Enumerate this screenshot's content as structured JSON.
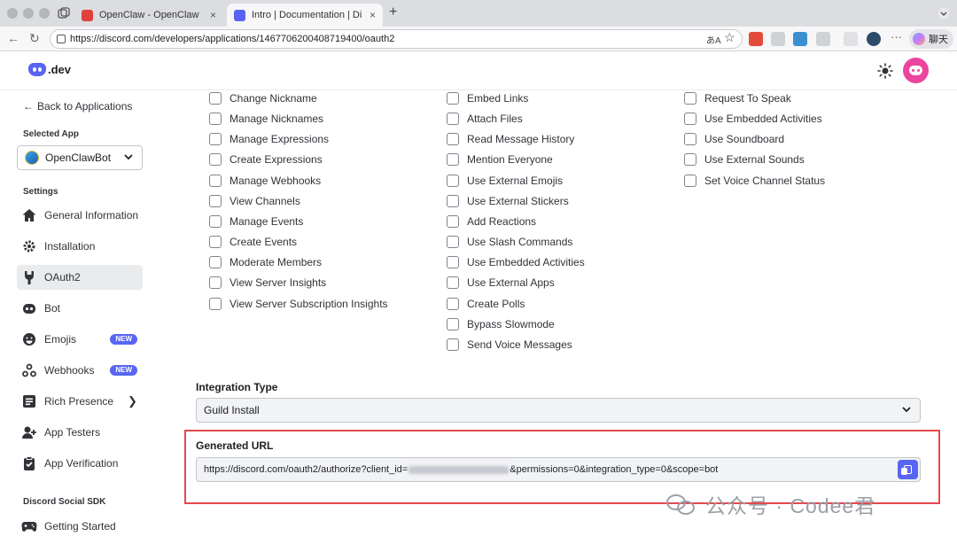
{
  "browser": {
    "tabs": [
      {
        "title": "OpenClaw - OpenClaw",
        "favicon_color": "#e0413a"
      },
      {
        "title": "Intro | Documentation | Discord D",
        "favicon_color": "#5865f2"
      }
    ],
    "url": "https://discord.com/developers/applications/1467706200408719400/oauth2",
    "chat_label": "聊天"
  },
  "header": {
    "logo_text": ".dev"
  },
  "sidebar": {
    "back_label": "Back to Applications",
    "selected_app_label": "Selected App",
    "selected_app": "OpenClawBot",
    "settings_label": "Settings",
    "items": [
      {
        "label": "General Information"
      },
      {
        "label": "Installation"
      },
      {
        "label": "OAuth2"
      },
      {
        "label": "Bot"
      },
      {
        "label": "Emojis",
        "badge": "NEW"
      },
      {
        "label": "Webhooks",
        "badge": "NEW"
      },
      {
        "label": "Rich Presence"
      },
      {
        "label": "App Testers"
      },
      {
        "label": "App Verification"
      }
    ],
    "sdk_label": "Discord Social SDK",
    "sdk_items": [
      {
        "label": "Getting Started"
      }
    ]
  },
  "permissions": {
    "col1": [
      "Change Nickname",
      "Manage Nicknames",
      "Manage Expressions",
      "Create Expressions",
      "Manage Webhooks",
      "View Channels",
      "Manage Events",
      "Create Events",
      "Moderate Members",
      "View Server Insights",
      "View Server Subscription Insights"
    ],
    "col2": [
      "Embed Links",
      "Attach Files",
      "Read Message History",
      "Mention Everyone",
      "Use External Emojis",
      "Use External Stickers",
      "Add Reactions",
      "Use Slash Commands",
      "Use Embedded Activities",
      "Use External Apps",
      "Create Polls",
      "Bypass Slowmode",
      "Send Voice Messages"
    ],
    "col3": [
      "Request To Speak",
      "Use Embedded Activities",
      "Use Soundboard",
      "Use External Sounds",
      "Set Voice Channel Status"
    ]
  },
  "integration": {
    "label": "Integration Type",
    "value": "Guild Install"
  },
  "generated": {
    "label": "Generated URL",
    "url_prefix": "https://discord.com/oauth2/authorize?client_id=",
    "url_suffix": "&permissions=0&integration_type=0&scope=bot"
  },
  "watermark": "公众号 · Codee君",
  "colors": {
    "brand": "#5865f2",
    "avatar": "#eb459e",
    "highlight": "#e5484d"
  }
}
